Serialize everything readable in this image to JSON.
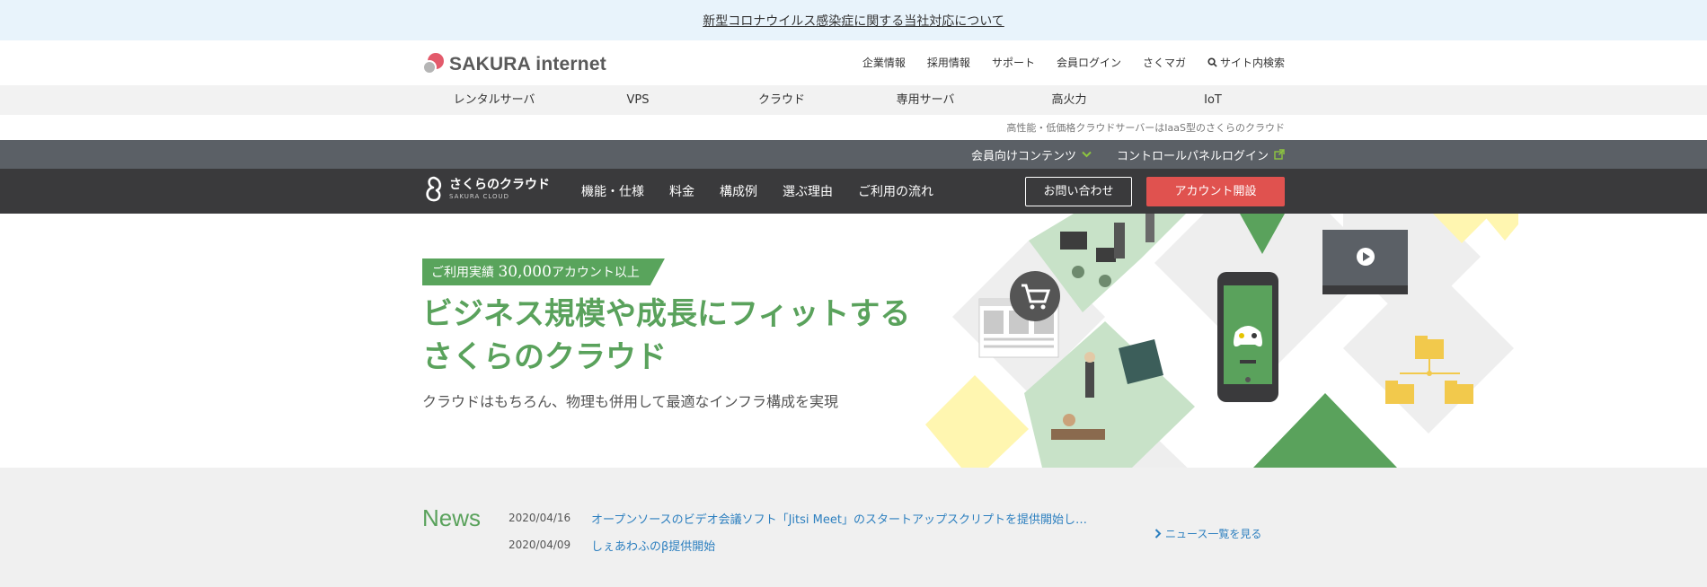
{
  "notice": {
    "text": "新型コロナウイルス感染症に関する当社対応について"
  },
  "header": {
    "logo_text": "SAKURA internet",
    "links": [
      "企業情報",
      "採用情報",
      "サポート",
      "会員ログイン",
      "さくマガ"
    ],
    "search_label": "サイト内検索"
  },
  "product_nav": {
    "items": [
      "レンタルサーバ",
      "VPS",
      "クラウド",
      "専用サーバ",
      "高火力",
      "IoT"
    ]
  },
  "tagline": "高性能・低価格クラウドサーバーはIaaS型のさくらのクラウド",
  "member_bar": {
    "members_label": "会員向けコンテンツ",
    "control_panel_label": "コントロールパネルログイン"
  },
  "cloud_nav": {
    "logo_text": "さくらのクラウド",
    "logo_sub": "SAKURA CLOUD",
    "items": [
      "機能・仕様",
      "料金",
      "構成例",
      "選ぶ理由",
      "ご利用の流れ"
    ],
    "contact_label": "お問い合わせ",
    "signup_label": "アカウント開設"
  },
  "hero": {
    "badge_prefix": "ご利用実績",
    "badge_number": "30,000",
    "badge_suffix": "アカウント以上",
    "title_line1": "ビジネス規模や成長にフィットする",
    "title_line2": "さくらのクラウド",
    "subtitle": "クラウドはもちろん、物理も併用して最適なインフラ構成を実現"
  },
  "news": {
    "title": "News",
    "items": [
      {
        "date": "2020/04/16",
        "text": "オープンソースのビデオ会議ソフト「Jitsi Meet」のスタートアップスクリプトを提供開始し…"
      },
      {
        "date": "2020/04/09",
        "text": "しぇあわふのβ提供開始"
      }
    ],
    "more_label": "ニュース一覧を見る"
  },
  "colors": {
    "accent_green": "#5aa25c",
    "signup_red": "#e0524f",
    "nav_dark": "#3a3a3c",
    "member_bar": "#5b6066",
    "link_blue": "#2c7fbf"
  }
}
